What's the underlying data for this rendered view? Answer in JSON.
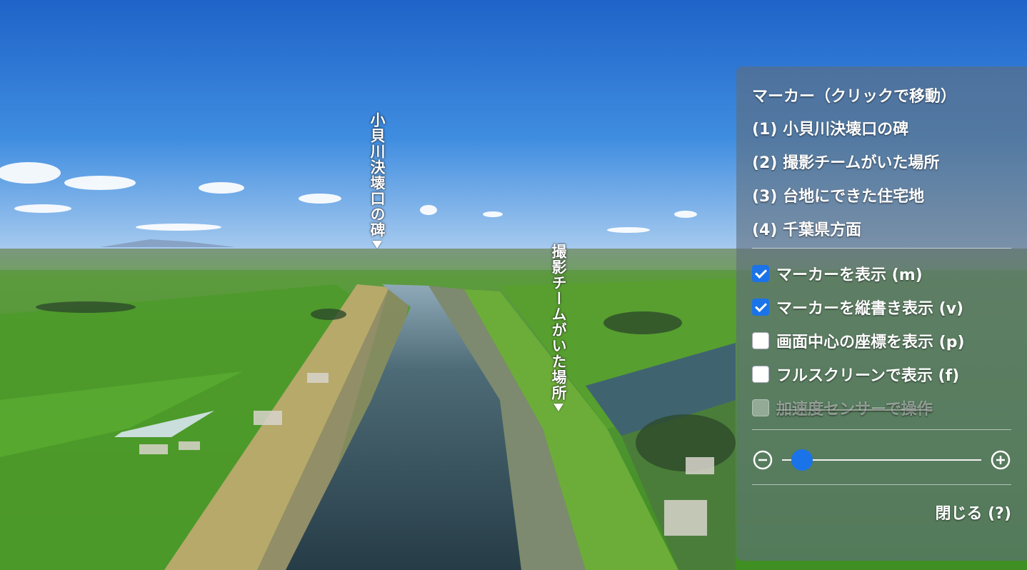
{
  "markers_on_view": [
    {
      "label": "小貝川決壊口の碑"
    },
    {
      "label": "撮影チームがいた場所"
    }
  ],
  "panel": {
    "title": "マーカー（クリックで移動）",
    "markers": [
      "(1) 小貝川決壊口の碑",
      "(2) 撮影チームがいた場所",
      "(3) 台地にできた住宅地",
      "(4) 千葉県方面"
    ],
    "options": [
      {
        "label": "マーカーを表示 (m)",
        "checked": true
      },
      {
        "label": "マーカーを縦書き表示 (v)",
        "checked": true
      },
      {
        "label": "画面中心の座標を表示 (p)",
        "checked": false
      },
      {
        "label": "フルスクリーンで表示 (f)",
        "checked": false
      },
      {
        "label": "加速度センサーで操作",
        "checked": false,
        "disabled": true
      }
    ],
    "zoom": {
      "level": 0.1,
      "minus_icon": "zoom-out-icon",
      "plus_icon": "zoom-in-icon"
    },
    "close_label": "閉じる (?)"
  },
  "colors": {
    "accent": "#1a73e8",
    "sky": "#2d6fcf",
    "field": "#4e9a2c",
    "river": "#3b5a63"
  }
}
